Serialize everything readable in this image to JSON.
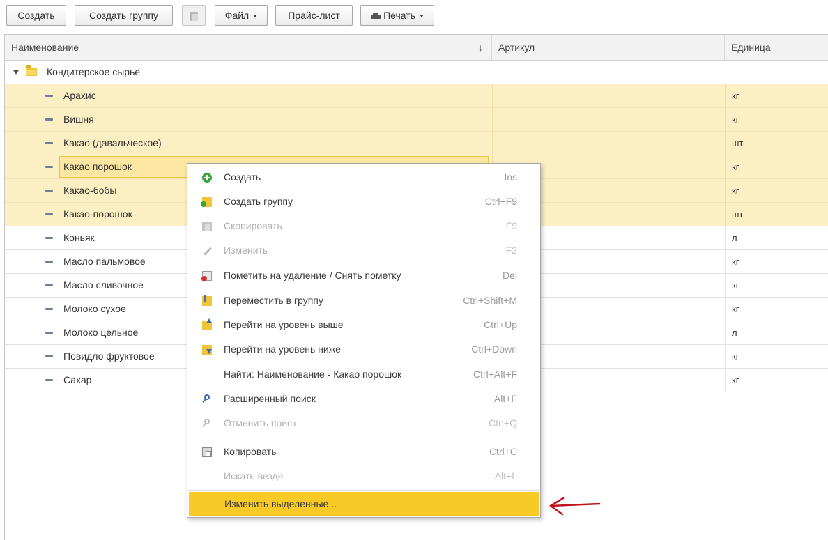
{
  "toolbar": {
    "create": "Создать",
    "create_group": "Создать группу",
    "file": "Файл",
    "price_list": "Прайс-лист",
    "print": "Печать"
  },
  "table": {
    "columns": {
      "name": "Наименование",
      "sort_indicator": "↓",
      "article": "Артикул",
      "unit": "Единица"
    },
    "group": "Кондитерское сырье",
    "rows": [
      {
        "name": "Арахис",
        "article": "",
        "unit": "кг"
      },
      {
        "name": "Вишня",
        "article": "",
        "unit": "кг"
      },
      {
        "name": "Какао (давальческое)",
        "article": "",
        "unit": "шт"
      },
      {
        "name": "Какао порошок",
        "article": "",
        "unit": "кг"
      },
      {
        "name": "Какао-бобы",
        "article": "",
        "unit": "кг"
      },
      {
        "name": "Какао-порошок",
        "article": "",
        "unit": "шт"
      },
      {
        "name": "Коньяк",
        "article": "",
        "unit": "л"
      },
      {
        "name": "Масло пальмовое",
        "article": "",
        "unit": "кг"
      },
      {
        "name": "Масло сливочное",
        "article": "",
        "unit": "кг"
      },
      {
        "name": "Молоко сухое",
        "article": "",
        "unit": "кг"
      },
      {
        "name": "Молоко цельное",
        "article": "",
        "unit": "л"
      },
      {
        "name": "Повидло фруктовое",
        "article": "",
        "unit": "кг"
      },
      {
        "name": "Сахар",
        "article": "",
        "unit": "кг"
      }
    ]
  },
  "context_menu": {
    "items": [
      {
        "label": "Создать",
        "shortcut": "Ins"
      },
      {
        "label": "Создать группу",
        "shortcut": "Ctrl+F9"
      },
      {
        "label": "Скопировать",
        "shortcut": "F9"
      },
      {
        "label": "Изменить",
        "shortcut": "F2"
      },
      {
        "label": "Пометить на удаление / Снять пометку",
        "shortcut": "Del"
      },
      {
        "label": "Переместить в группу",
        "shortcut": "Ctrl+Shift+M"
      },
      {
        "label": "Перейти на уровень выше",
        "shortcut": "Ctrl+Up"
      },
      {
        "label": "Перейти на уровень ниже",
        "shortcut": "Ctrl+Down"
      },
      {
        "label": "Найти: Наименование - Какао порошок",
        "shortcut": "Ctrl+Alt+F"
      },
      {
        "label": "Расширенный поиск",
        "shortcut": "Alt+F"
      },
      {
        "label": "Отменить поиск",
        "shortcut": "Ctrl+Q"
      },
      {
        "label": "Копировать",
        "shortcut": "Ctrl+C"
      },
      {
        "label": "Искать везде",
        "shortcut": "Alt+L"
      },
      {
        "label": "Изменить выделенные...",
        "shortcut": ""
      }
    ]
  },
  "colors": {
    "selection_row": "#fcefc3",
    "focused_cell": "#fbe7a1",
    "menu_highlight": "#f8ca28",
    "annotation_arrow": "#c0141c"
  }
}
